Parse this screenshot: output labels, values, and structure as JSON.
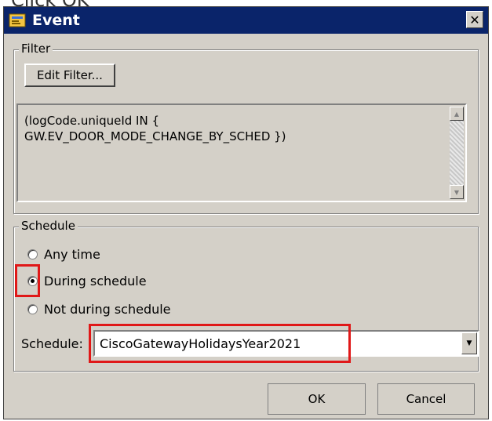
{
  "caption": "Click OK",
  "window": {
    "title": "Event",
    "close_glyph": "✕"
  },
  "filter": {
    "label": "Filter",
    "edit_button": "Edit Filter...",
    "expression": "(logCode.uniqueId IN {\nGW.EV_DOOR_MODE_CHANGE_BY_SCHED })"
  },
  "schedule": {
    "label": "Schedule",
    "options": [
      "Any time",
      "During schedule",
      "Not during schedule"
    ],
    "selected_index": 1,
    "field_label": "Schedule:",
    "field_value": "CiscoGatewayHolidaysYear2021"
  },
  "buttons": {
    "ok": "OK",
    "cancel": "Cancel"
  },
  "colors": {
    "highlight": "#e01818",
    "titlebar": "#0a246a",
    "dialog_bg": "#d4d0c8"
  },
  "icons": {
    "title": "event-app-icon",
    "scroll_up": "scroll-up-arrow",
    "scroll_down": "scroll-down-arrow",
    "dropdown": "dropdown-arrow"
  }
}
